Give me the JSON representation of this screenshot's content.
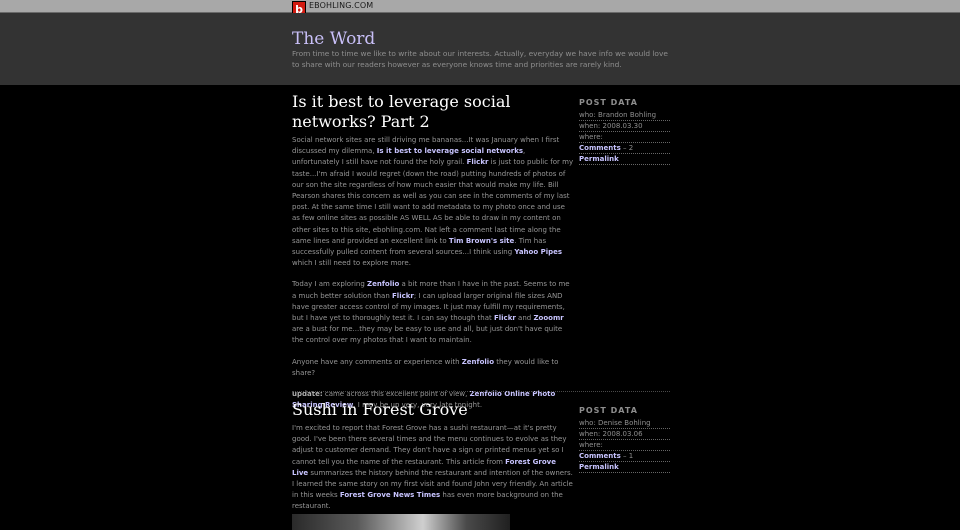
{
  "site": {
    "logo_letter": "b",
    "name": "EBOHLING.COM"
  },
  "header": {
    "title": "The Word",
    "tagline": "From time to time we like to write about our interests. Actually, everyday we have info we would love to share with our readers however as everyone knows time and priorities are rarely kind."
  },
  "post1": {
    "title": "Is it best to leverage social networks? Part 2",
    "p1": {
      "a": "Social network sites are still driving me bananas...It was January when I first discussed my dilemma, ",
      "link1": "Is it best to leverage social networks",
      "b": ", unfortunately I still have not found the holy grail. ",
      "link2": "Flickr",
      "c": " is just too public for my taste...I'm afraid I would regret (down the road) putting hundreds of photos of our son the site regardless of how much easier that would make my life. Bill Pearson shares this concern as well as you can see in the comments of my last post. At the same time I still want to add metadata to my photo once and use as few online sites as possible AS WELL AS be able to draw in my content on other sites to this site, ebohling.com. Nat left a comment last time along the same lines and provided an excellent link to ",
      "link3": "Tim Brown's site",
      "d": ". Tim has successfully pulled content from several sources...I think using ",
      "link4": "Yahoo Pipes",
      "e": " which I still need to explore more."
    },
    "p2": {
      "a": "Today I am exploring ",
      "link1": "Zenfolio",
      "b": " a bit more than I have in the past. Seems to me a much better solution than ",
      "link2": "Flickr",
      "c": "; I can upload larger original file sizes AND have greater access control of my images. It just may fulfill my requirements, but I have yet to thoroughly test it. I can say though that ",
      "link3": "Flickr",
      "d": " and ",
      "link4": "Zooomr",
      "e": " are a bust for me...they may be easy to use and all, but just don't have quite the control over my photos that I want to maintain."
    },
    "p3": {
      "a": "Anyone have any comments or experience with ",
      "link1": "Zenfolio",
      "b": " they would like to share?"
    },
    "p4": {
      "label": "update:",
      "a": " came across this excellent point of view, ",
      "link1": "Zenfolio Online Photo Sharing Review",
      "b": ". I may be up very, very late tonight."
    },
    "meta": {
      "heading": "POST DATA",
      "who": "who: Brandon Bohling",
      "when": "when: 2008.03.30",
      "where": "where:",
      "comments_link": "Comments",
      "comments_count": " – 2",
      "permalink": "Permalink"
    }
  },
  "post2": {
    "title": "Sushi in Forest Grove",
    "p1": {
      "a": "I'm excited to report that Forest Grove has a sushi restaurant—at it's pretty good. I've been there several times and the menu continues to evolve as they adjust to customer demand. They don't have a sign or printed menus yet so I cannot tell you the name of the restaurant. This article from ",
      "link1": "Forest Grove Live",
      "b": " summarizes the history behind the restaurant and intention of the owners. I learned the same story on my first visit and found John very friendly. An article in this weeks ",
      "link2": "Forest Grove News Times",
      "c": " has even more background on the restaurant."
    },
    "meta": {
      "heading": "POST DATA",
      "who": "who: Denise Bohling",
      "when": "when: 2008.03.06",
      "where": "where:",
      "comments_link": "Comments",
      "comments_count": " – 1",
      "permalink": "Permalink"
    }
  },
  "colors": {
    "accent": "#c8bff7",
    "link": "#c8c4ff",
    "background": "#000000",
    "header": "#333333",
    "logo": "#d21a10"
  }
}
